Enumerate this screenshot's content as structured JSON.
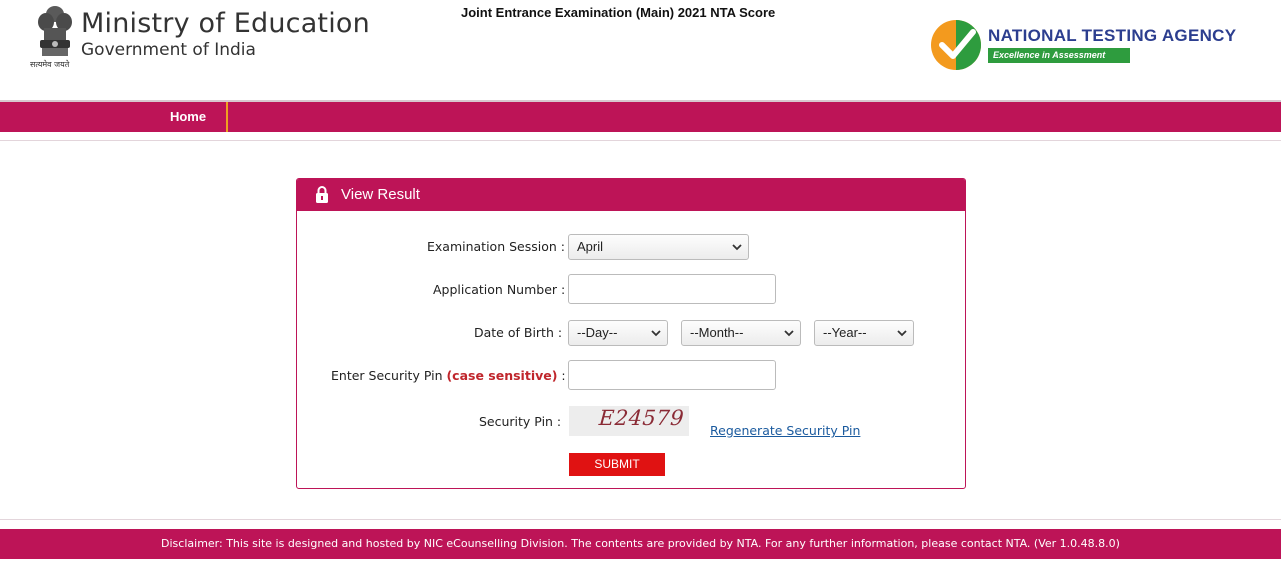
{
  "header": {
    "ministry_title": "Ministry of Education",
    "ministry_subtitle": "Government of India",
    "emblem_motto": "सत्यमेव जयते",
    "exam_title": "Joint Entrance Examination (Main) 2021 NTA Score",
    "agency_name": "NATIONAL TESTING AGENCY",
    "agency_tagline": "Excellence in Assessment"
  },
  "nav": {
    "items": [
      {
        "label": "Home"
      }
    ]
  },
  "form": {
    "title": "View Result",
    "session_label": "Examination Session :",
    "session_value": "April",
    "application_label": "Application Number :",
    "application_value": "",
    "dob_label": "Date of Birth :",
    "dob_day": "--Day--",
    "dob_month": "--Month--",
    "dob_year": "--Year--",
    "pin_label_prefix": "Enter Security Pin ",
    "pin_label_emphasis": "(case sensitive)",
    "pin_label_suffix": " :",
    "pin_value": "",
    "captcha_label": "Security Pin :",
    "captcha_text": "E24579",
    "regenerate_label": "Regenerate Security Pin",
    "submit_label": "SUBMIT"
  },
  "footer": {
    "disclaimer": "Disclaimer: This site is designed and hosted by NIC eCounselling Division. The contents are provided by NTA. For any further information, please contact NTA. (Ver 1.0.48.8.0)"
  },
  "colors": {
    "brand": "#bd1457",
    "submit": "#e01212",
    "agency_blue": "#2c3e8f",
    "agency_green": "#2e9c3e",
    "link": "#1a5a9e"
  },
  "icons": {
    "emblem": "national-emblem-icon",
    "agency_logo": "nta-check-logo-icon",
    "lock": "lock-icon",
    "chevron": "chevron-down-icon"
  }
}
